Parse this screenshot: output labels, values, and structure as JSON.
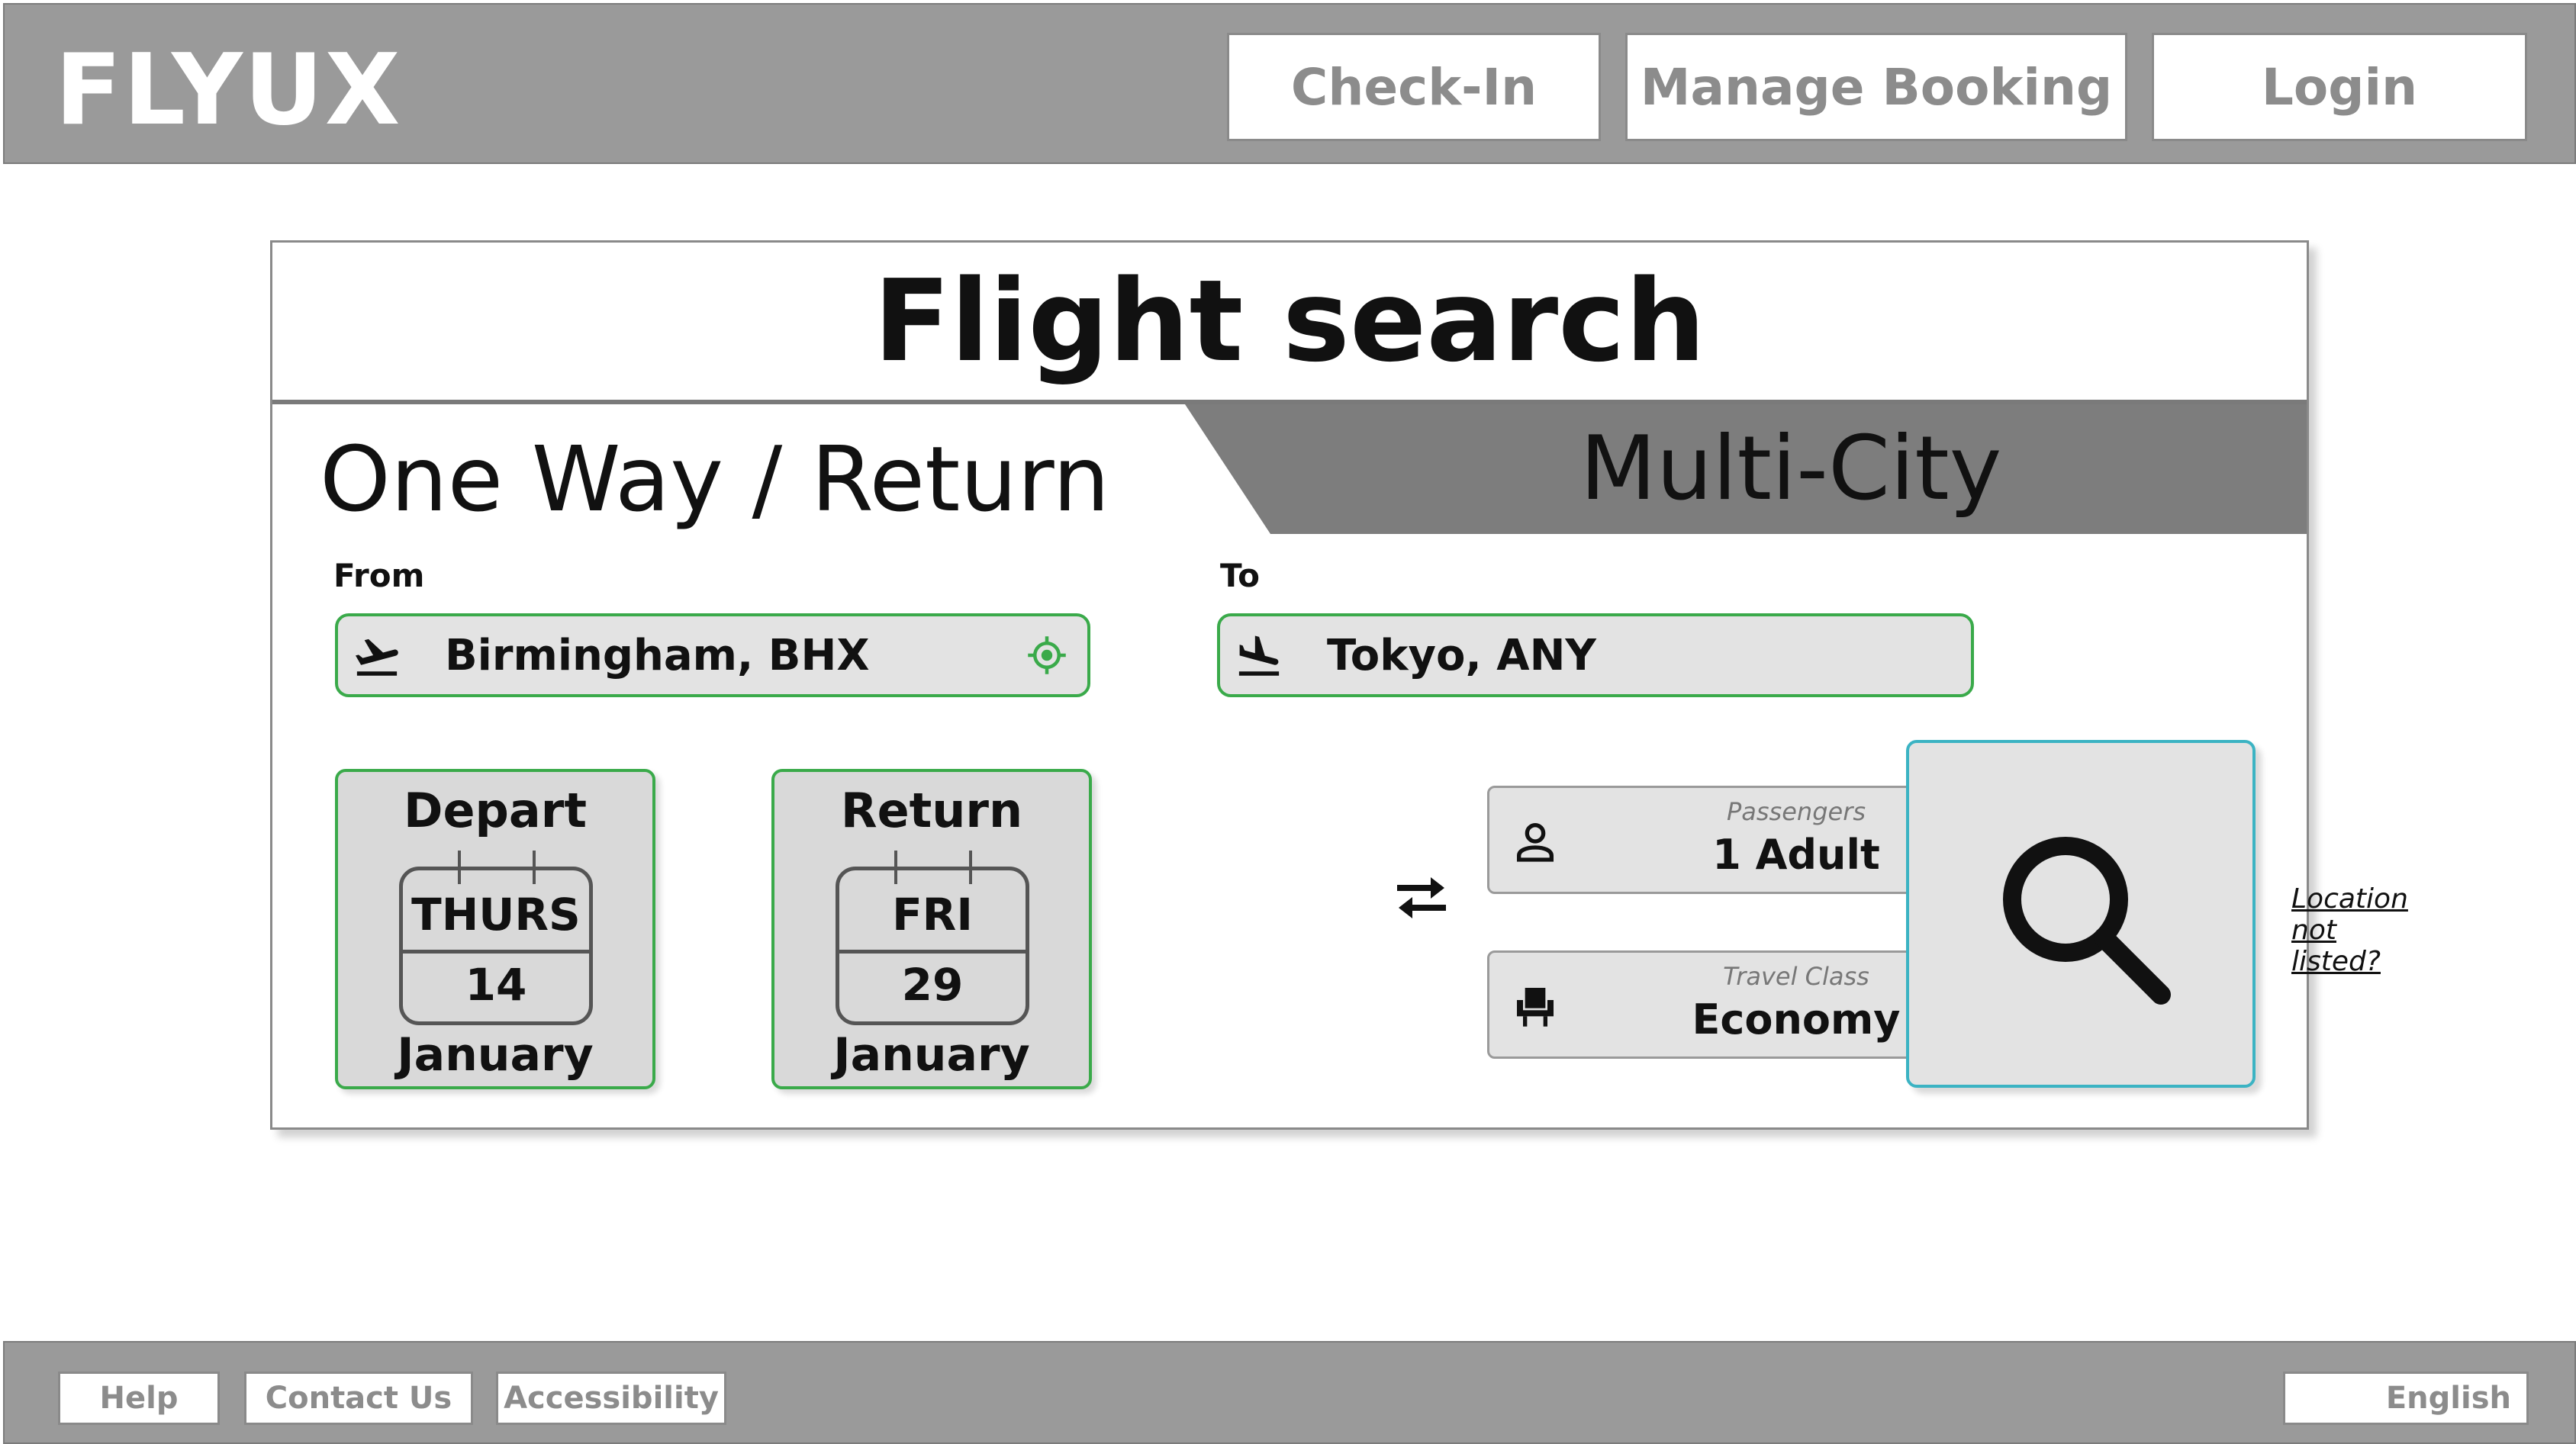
{
  "header": {
    "logo": "FLYUX",
    "nav": {
      "checkin": "Check-In",
      "manage": "Manage Booking",
      "login": "Login"
    }
  },
  "search": {
    "title": "Flight search",
    "tabs": {
      "active": "One Way / Return",
      "inactive": "Multi-City"
    },
    "from": {
      "label": "From",
      "value": "Birmingham, BHX"
    },
    "to": {
      "label": "To",
      "value": "Tokyo, ANY"
    },
    "location_not_listed": "Location not listed?",
    "depart": {
      "title": "Depart",
      "day": "THURS",
      "date": "14",
      "month": "January"
    },
    "return": {
      "title": "Return",
      "day": "FRI",
      "date": "29",
      "month": "January"
    },
    "passengers": {
      "label": "Passengers",
      "value": "1 Adult"
    },
    "travel_class": {
      "label": "Travel Class",
      "value": "Economy"
    }
  },
  "footer": {
    "help": "Help",
    "contact": "Contact Us",
    "accessibility": "Accessibility",
    "language": "English"
  },
  "colors": {
    "header_bg": "#9a9a9a",
    "field_border": "#3aaa4a",
    "search_border": "#3bb3c3",
    "tab_inactive_bg": "#7d7d7d"
  }
}
